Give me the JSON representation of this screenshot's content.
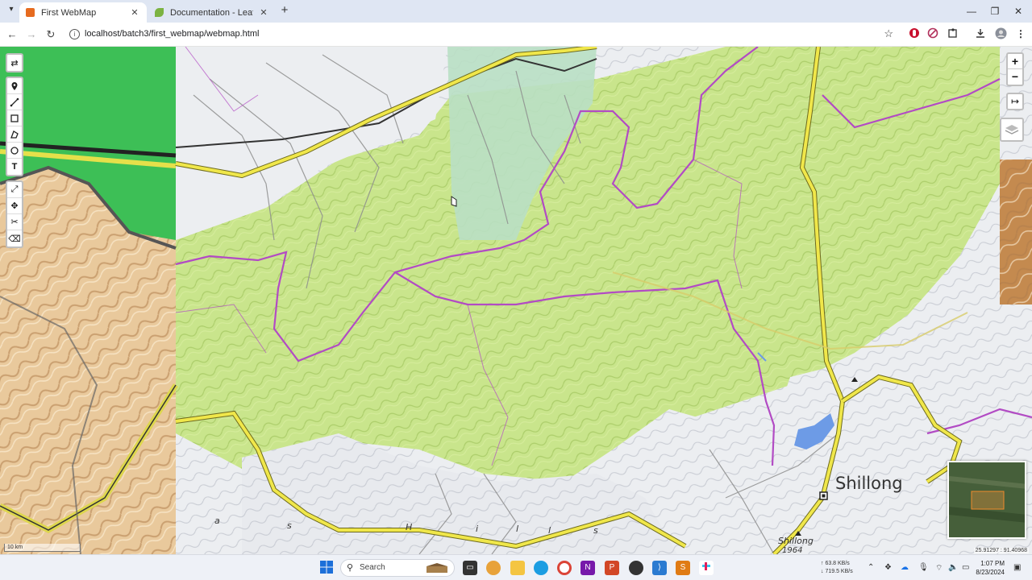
{
  "browser": {
    "tabs": [
      {
        "title": "First WebMap",
        "active": true,
        "favicon_color": "#e66b1f"
      },
      {
        "title": "Documentation - Leaflet - a Jav",
        "active": false,
        "favicon_color": "#7cb342"
      }
    ],
    "url": "localhost/batch3/first_webmap/webmap.html",
    "icons": {
      "tab_search": "chevron-down-icon",
      "new_tab": "plus-icon",
      "back": "arrow-left-icon",
      "forward": "arrow-right-icon",
      "reload": "reload-icon",
      "site_info": "info-icon",
      "bookmark": "star-icon",
      "download": "download-icon",
      "menu": "kebab-menu-icon"
    }
  },
  "map": {
    "place_label": "Shillong",
    "peak_label": "Shillong",
    "peak_elevation": "1964",
    "scattered_letters": [
      "a",
      "s",
      "H",
      "i",
      "l",
      "l",
      "s"
    ],
    "scale_label": "10 km",
    "coordinates": "25.91297 : 91.40968",
    "zoom_in": "+",
    "zoom_out": "−",
    "colors": {
      "forest": "#c9e58c",
      "forest_shade": "#a9cf63",
      "bare": "#eaebee",
      "wetland": "#b9dfc4",
      "boundary": "#b24bc4",
      "road_major": "#f0e74a",
      "road_casing": "#6d6a1f",
      "water": "#6d9be6"
    }
  },
  "draw_toolbar": {
    "top_tool": "swap-icon",
    "tools": [
      "marker-icon",
      "polyline-icon",
      "rectangle-icon",
      "polygon-icon",
      "circle-icon",
      "text-icon"
    ],
    "edit_tools": [
      "rotate-icon",
      "move-icon",
      "cut-icon",
      "eraser-icon"
    ]
  },
  "taskbar": {
    "search_placeholder": "Search",
    "net_up": "↑ 63.8 KB/s",
    "net_down": "↓ 719.5 KB/s",
    "time": "1:07 PM",
    "date": "8/23/2024"
  }
}
